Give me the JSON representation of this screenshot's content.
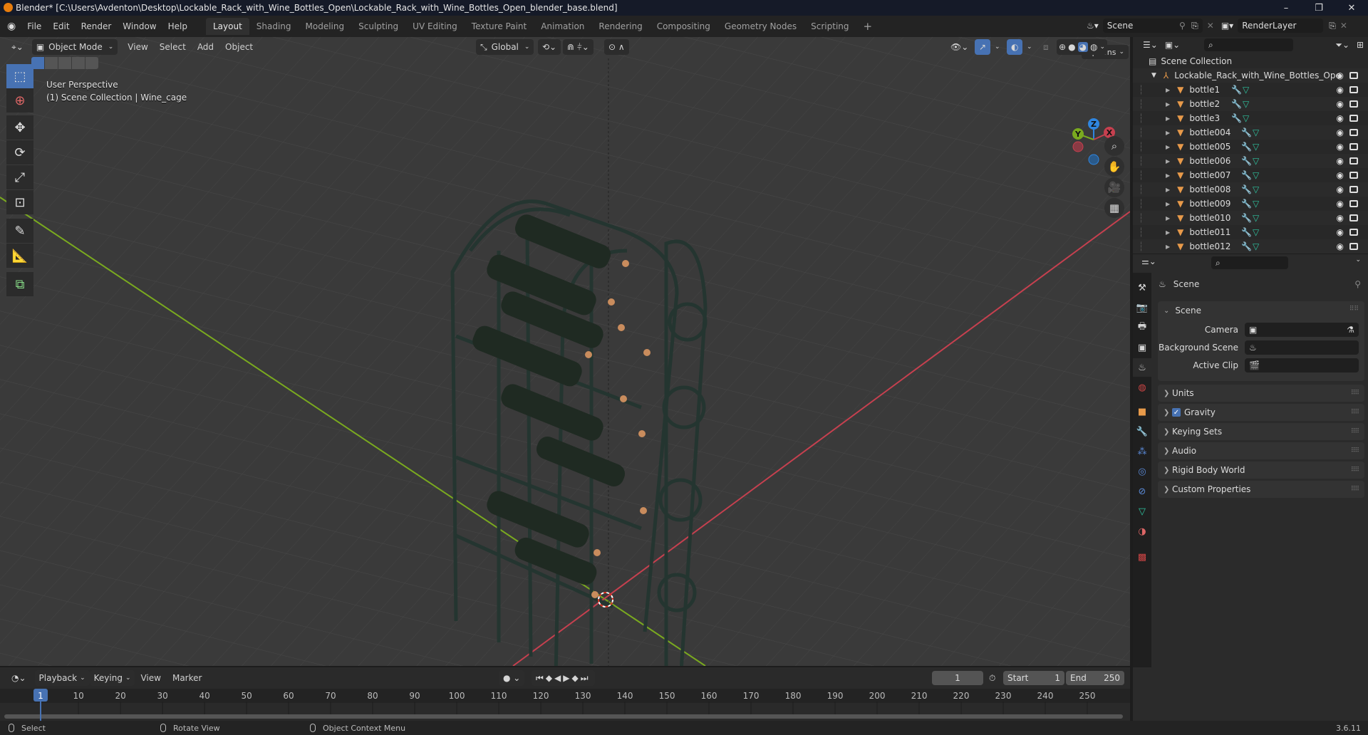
{
  "window": {
    "title": "Blender* [C:\\Users\\Avdenton\\Desktop\\Lockable_Rack_with_Wine_Bottles_Open\\Lockable_Rack_with_Wine_Bottles_Open_blender_base.blend]",
    "controls": {
      "minimize": "–",
      "maximize": "❐",
      "close": "✕"
    }
  },
  "menubar": {
    "menus": [
      "File",
      "Edit",
      "Render",
      "Window",
      "Help"
    ],
    "workspaces": [
      "Layout",
      "Shading",
      "Modeling",
      "Sculpting",
      "UV Editing",
      "Texture Paint",
      "Animation",
      "Rendering",
      "Compositing",
      "Geometry Nodes",
      "Scripting"
    ],
    "active_workspace": "Layout",
    "add_workspace": "+",
    "scene": "Scene",
    "view_layer": "RenderLayer"
  },
  "viewport": {
    "mode": "Object Mode",
    "menus": [
      "View",
      "Select",
      "Add",
      "Object"
    ],
    "orientation": "Global",
    "options_label": "Options",
    "overlay_text": {
      "line1": "User Perspective",
      "line2": "(1) Scene Collection | Wine_cage"
    },
    "gizmo": {
      "z": "Z",
      "y": "Y",
      "x": "X"
    },
    "colors": {
      "accent": "#4772b3",
      "x_axis": "#c6404f",
      "y_axis": "#7aaa1f",
      "z_axis": "#2f86e0"
    },
    "tools": [
      "select-box",
      "cursor",
      "move",
      "rotate",
      "scale",
      "transform",
      "annotate",
      "measure",
      "add-cube"
    ],
    "nav": [
      "zoom",
      "pan",
      "camera",
      "ortho-grid"
    ]
  },
  "outliner": {
    "root": "Scene Collection",
    "collection": "Lockable_Rack_with_Wine_Bottles_Ope",
    "objects": [
      "bottle1",
      "bottle2",
      "bottle3",
      "bottle004",
      "bottle005",
      "bottle006",
      "bottle007",
      "bottle008",
      "bottle009",
      "bottle010",
      "bottle011",
      "bottle012"
    ]
  },
  "properties": {
    "context": "Scene",
    "section": "Scene",
    "fields": [
      {
        "label": "Camera",
        "value": ""
      },
      {
        "label": "Background Scene",
        "value": ""
      },
      {
        "label": "Active Clip",
        "value": ""
      }
    ],
    "panels": [
      {
        "label": "Units",
        "checkbox": null
      },
      {
        "label": "Gravity",
        "checkbox": true
      },
      {
        "label": "Keying Sets",
        "checkbox": null
      },
      {
        "label": "Audio",
        "checkbox": null
      },
      {
        "label": "Rigid Body World",
        "checkbox": null
      },
      {
        "label": "Custom Properties",
        "checkbox": null
      }
    ]
  },
  "timeline": {
    "menus": [
      "Playback",
      "Keying",
      "View",
      "Marker"
    ],
    "current_frame": "1",
    "start_label": "Start",
    "start": "1",
    "end_label": "End",
    "end": "250",
    "ticks": [
      "10",
      "20",
      "30",
      "40",
      "50",
      "60",
      "70",
      "80",
      "90",
      "100",
      "110",
      "120",
      "130",
      "140",
      "150",
      "160",
      "170",
      "180",
      "190",
      "200",
      "210",
      "220",
      "230",
      "240",
      "250"
    ],
    "playhead": "1"
  },
  "statusbar": {
    "select": "Select",
    "rotate": "Rotate View",
    "context_menu": "Object Context Menu",
    "version": "3.6.11"
  }
}
